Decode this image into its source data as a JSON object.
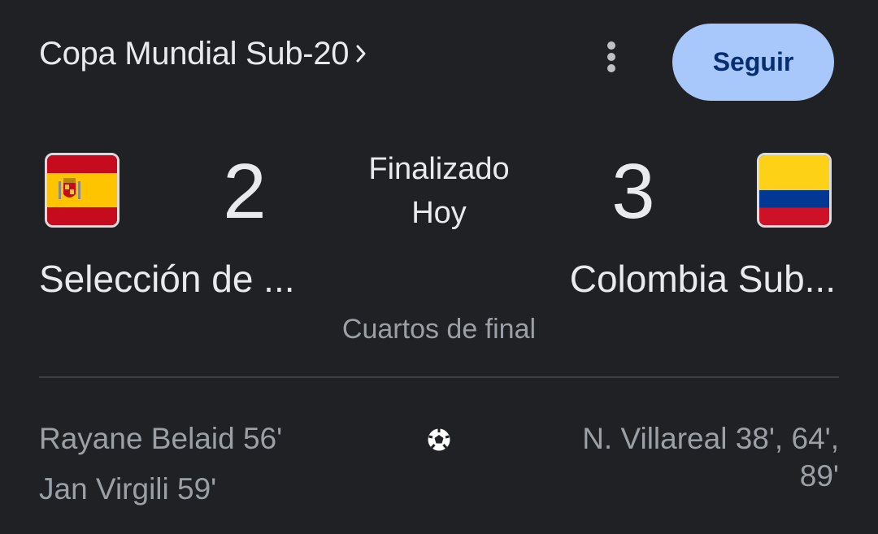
{
  "header": {
    "competition": "Copa Mundial Sub-20",
    "follow_label": "Seguir",
    "more_icon": "more-vert-icon",
    "chevron_icon": "chevron-right-icon"
  },
  "match": {
    "home": {
      "name": "Selección de ...",
      "score": "2",
      "flag_icon": "spain-flag-icon",
      "scorers": [
        "Rayane Belaid 56'",
        "Jan Virgili 59'"
      ]
    },
    "away": {
      "name": "Colombia Sub...",
      "score": "3",
      "flag_icon": "colombia-flag-icon",
      "scorers": [
        "N. Villareal 38', 64',",
        "89'"
      ]
    },
    "status": "Finalizado",
    "date": "Hoy",
    "round": "Cuartos de final",
    "goal_icon": "soccer-ball-icon"
  },
  "colors": {
    "background": "#202124",
    "primary_text": "#e8eaed",
    "secondary_text": "#9aa0a6",
    "follow_button_bg": "#a8c7fa",
    "follow_button_text": "#062e6f",
    "divider": "#3c4043"
  }
}
